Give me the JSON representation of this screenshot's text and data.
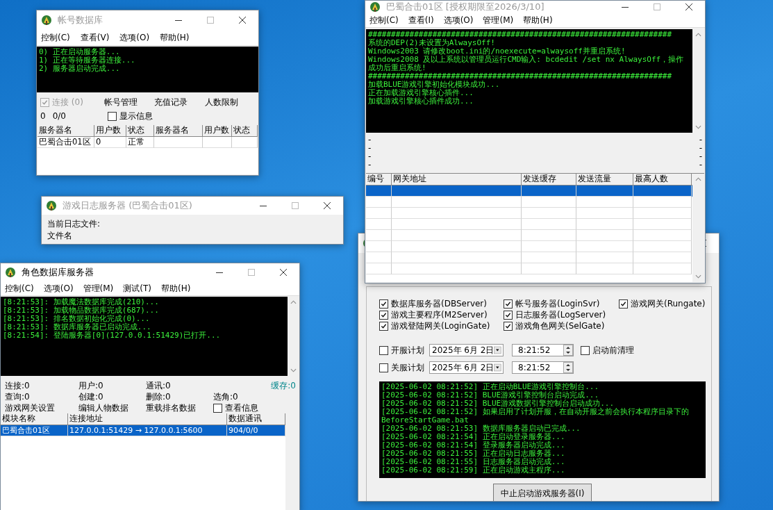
{
  "account_db": {
    "title": "帐号数据库",
    "active": false,
    "menu": [
      "控制(C)",
      "查看(V)",
      "选项(O)",
      "帮助(H)"
    ],
    "console": [
      "0) 正在启动服务器...",
      "1) 正在等待服务器连接...",
      "2) 服务器启动完成..."
    ],
    "connect": {
      "label": "连接 (0)",
      "checked": true,
      "disabled": true
    },
    "buttons": [
      "帐号管理",
      "充值记录",
      "人数限制"
    ],
    "counters": [
      "0",
      "0/0"
    ],
    "show_info": {
      "label": "显示信息",
      "checked": false
    },
    "table": {
      "columns": [
        "服务器名",
        "用户数",
        "状态",
        "服务器名",
        "用户数",
        "状态"
      ],
      "rows": [
        {
          "cells": [
            "巴蜀合击01区",
            "0",
            "正常"
          ]
        }
      ]
    }
  },
  "log_server": {
    "title": "游戏日志服务器 (巴蜀合击01区)",
    "active": false,
    "labels": [
      "当前日志文件:",
      "文件名"
    ]
  },
  "role_db": {
    "title": "角色数据库服务器",
    "active": true,
    "menu": [
      "控制(C)",
      "选项(O)",
      "管理(M)",
      "测试(T)",
      "帮助(H)"
    ],
    "console": [
      "[8:21:53]: 加载魔法数据库完成(210)...",
      "[8:21:53]: 加载物品数据库完成(687)...",
      "[8:21:53]: 排名数据初始化完成(0)...",
      "[8:21:53]: 数据库服务器已启动完成...",
      "[8:21:54]: 登陆服务器[0](127.0.0.1:51429)已打开..."
    ],
    "stats": [
      {
        "text": "连接:0",
        "kind": "counter"
      },
      {
        "text": "用户:0",
        "kind": "counter"
      },
      {
        "text": "通讯:0",
        "kind": "counter"
      },
      {
        "text": "缓存:0",
        "kind": "buffer"
      },
      {
        "text": "查询:0",
        "kind": "counter"
      },
      {
        "text": "创建:0",
        "kind": "counter"
      },
      {
        "text": "删除:0",
        "kind": "counter"
      },
      {
        "text": "选角:0",
        "kind": "counter"
      }
    ],
    "actions": [
      "游戏网关设置",
      "编辑人物数据",
      "重载排名数据"
    ],
    "view_info": {
      "label": "查看信息",
      "checked": false
    },
    "table": {
      "columns": [
        "模块名称",
        "连接地址",
        "数据通讯"
      ],
      "rows": [
        {
          "cells": [
            "巴蜀合击01区",
            "127.0.0.1:51429 → 127.0.0.1:5600",
            "904/0/0"
          ],
          "selected": true
        }
      ]
    }
  },
  "console_main": {
    "title": "巴蜀合击01区 [授权期限至2026/3/10]",
    "active": false,
    "menu": [
      "控制(C)",
      "查看(I)",
      "选项(O)",
      "管理(M)",
      "帮助(H)"
    ],
    "console": [
      "##################################################################",
      "系统的DEP(2)未设置为AlwaysOff!",
      "Windows2003 请修改boot.ini的/noexecute=alwaysoff并重启系统!",
      "Windows2008 及以上系统以管理员运行CMD输入: bcdedit /set nx AlwaysOff，操作成功后重启系统!",
      "##################################################################",
      "加载BLUE游戏引擎初始化模块成功...",
      "正在加载游戏引擎核心插件...",
      "加载游戏引擎核心插件成功..."
    ],
    "status_left": [
      "-",
      "-",
      "-",
      "-"
    ],
    "status_right": [
      "-",
      "-",
      "-",
      "-"
    ],
    "table": {
      "columns": [
        "编号",
        "网关地址",
        "发送缓存",
        "发送流量",
        "最高人数"
      ],
      "rows": [
        {
          "selected": true
        },
        {
          "selected": false
        },
        {
          "selected": false
        },
        {
          "selected": false
        },
        {
          "selected": false
        },
        {
          "selected": false
        },
        {
          "selected": false
        },
        {
          "selected": false
        }
      ]
    }
  },
  "launcher": {
    "services": [
      {
        "label": "数据库服务器(DBServer)",
        "checked": true
      },
      {
        "label": "游戏主要程序(M2Server)",
        "checked": true
      },
      {
        "label": "游戏登陆网关(LoginGate)",
        "checked": true
      },
      {
        "label": "帐号服务器(LoginSvr)",
        "checked": true
      },
      {
        "label": "日志服务器(LogServer)",
        "checked": true
      },
      {
        "label": "游戏角色网关(SelGate)",
        "checked": true
      },
      {
        "label": "游戏网关(Rungate)",
        "checked": true
      }
    ],
    "schedules": [
      {
        "label": "开服计划",
        "checked": false,
        "date": "2025年 6月 2日",
        "time": "8:21:52"
      },
      {
        "label": "关服计划",
        "checked": false,
        "date": "2025年 6月 2日",
        "time": "8:21:52"
      }
    ],
    "pre_clean": {
      "label": "启动前清理",
      "checked": false
    },
    "log": [
      "[2025-06-02 08:21:52] 正在启动BLUE游戏引擎控制台...",
      "[2025-06-02 08:21:52] BLUE游戏引擎控制台启动完成...",
      "[2025-06-02 08:21:52] BLUE游戏数据引擎控制台启动成功...",
      "[2025-06-02 08:21:52] 如果启用了计划开服，在自动开服之前会执行本程序目录下的",
      "BeforeStartGame.bat",
      "[2025-06-02 08:21:53] 数据库服务器启动已完成...",
      "[2025-06-02 08:21:54] 正在启动登录服务器...",
      "[2025-06-02 08:21:54] 登录服务器启动完成...",
      "[2025-06-02 08:21:55] 正在启动日志服务器...",
      "[2025-06-02 08:21:55] 日志服务器启动完成...",
      "[2025-06-02 08:21:59] 正在启动游戏主程序..."
    ],
    "button": "中止启动游戏服务器(I)"
  }
}
